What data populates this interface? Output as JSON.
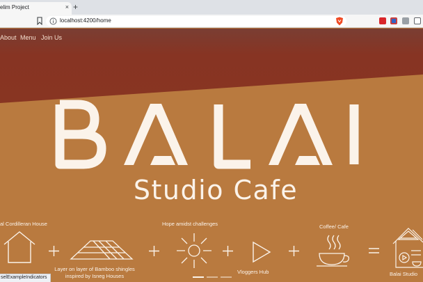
{
  "browser": {
    "tab_title": "elim Project",
    "tab_close": "×",
    "new_tab": "+",
    "url": "localhost:4200/home",
    "status_text": "selExampleIndicators"
  },
  "nav": {
    "items": [
      "About",
      "Menu",
      "Join Us"
    ]
  },
  "hero": {
    "brand_name": "BALAI",
    "brand_tagline": "Studio Cafe"
  },
  "equation": {
    "items": [
      {
        "caption_top": "al Cordilleran House",
        "symbol": "house-icon"
      },
      {
        "caption_bottom": "Layer on layer of Bamboo shingles inspired by Isneg Houses",
        "symbol": "roof-icon"
      },
      {
        "caption_top": "Hope amidst challenges",
        "symbol": "sun-icon"
      },
      {
        "caption_bottom": "Vloggers Hub",
        "symbol": "play-icon"
      },
      {
        "caption_top": "Coffee/ Cafe",
        "symbol": "coffee-cup-icon"
      },
      {
        "caption_bottom": "Balai Studio",
        "symbol": "balai-studio-icon"
      }
    ],
    "operators": [
      "+",
      "+",
      "+",
      "+",
      "="
    ]
  },
  "carousel": {
    "indicators": 3,
    "active_index": 0
  },
  "colors": {
    "band_top": "#7a3e33",
    "band_red": "#873423",
    "background": "#b97a3f",
    "text": "#fbf3ea",
    "nav_text": "#f3dfcf"
  }
}
